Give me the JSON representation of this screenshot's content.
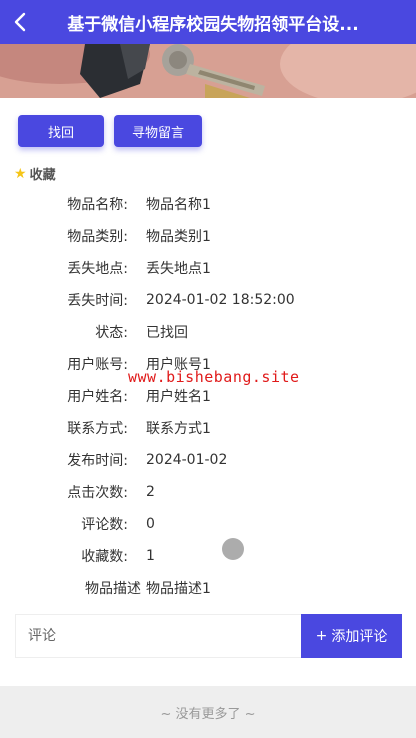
{
  "header": {
    "title": "基于微信小程序校园失物招领平台设..."
  },
  "actions": {
    "find_label": "找回",
    "message_label": "寻物留言"
  },
  "collect": {
    "icon": "star-icon",
    "label": "收藏"
  },
  "details": [
    {
      "key": "物品名称:",
      "value": "物品名称1"
    },
    {
      "key": "物品类别:",
      "value": "物品类别1"
    },
    {
      "key": "丢失地点:",
      "value": "丢失地点1"
    },
    {
      "key": "丢失时间:",
      "value": "2024-01-02 18:52:00"
    },
    {
      "key": "状态:",
      "value": "已找回"
    },
    {
      "key": "用户账号:",
      "value": "用户账号1"
    },
    {
      "key": "用户姓名:",
      "value": "用户姓名1"
    },
    {
      "key": "联系方式:",
      "value": "联系方式1"
    },
    {
      "key": "发布时间:",
      "value": "2024-01-02"
    },
    {
      "key": "点击次数:",
      "value": "2"
    },
    {
      "key": "评论数:",
      "value": "0"
    },
    {
      "key": "收藏数:",
      "value": "1"
    },
    {
      "key": "物品描述",
      "value": "物品描述1"
    }
  ],
  "watermark": "www.bishebang.site",
  "comment": {
    "placeholder": "评论",
    "add_label": "添加评论",
    "add_icon": "plus-icon"
  },
  "footer": {
    "text": "~ 没有更多了 ~"
  },
  "colors": {
    "primary": "#4a48e0",
    "watermark": "#e01a1a",
    "star": "#f5c518"
  }
}
